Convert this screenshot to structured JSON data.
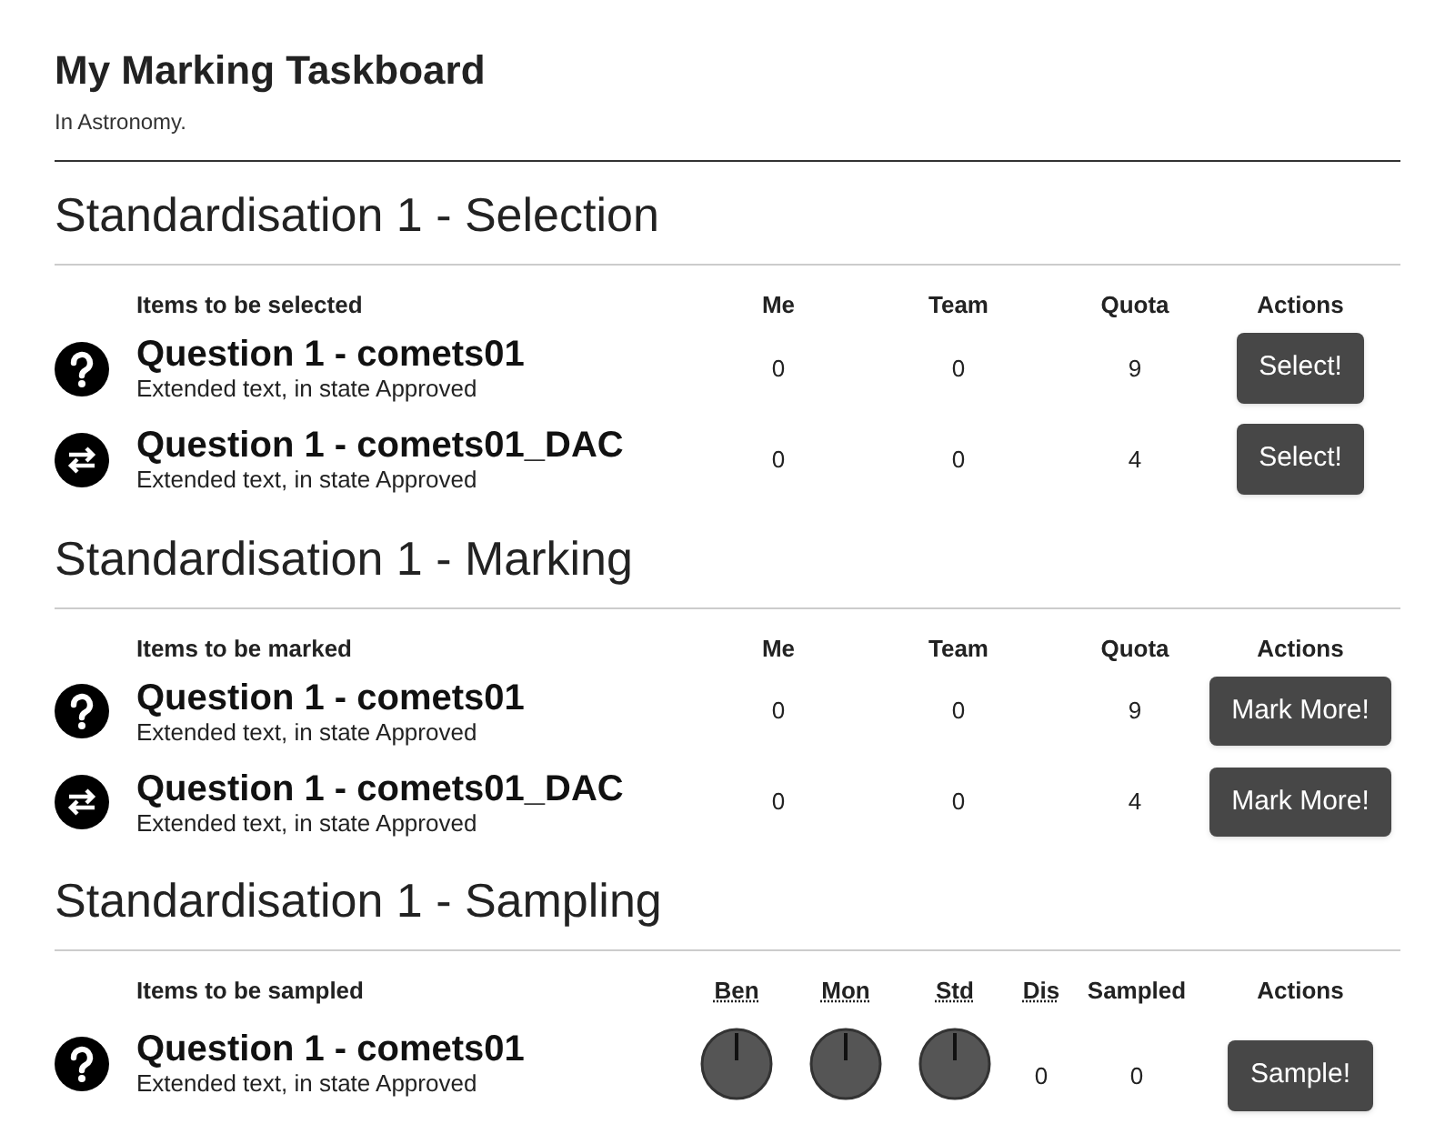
{
  "page": {
    "title": "My Marking Taskboard",
    "subtitle": "In Astronomy."
  },
  "sections": [
    {
      "kind": "standard",
      "heading": "Standardisation 1 - Selection",
      "columns": [
        "Items to be selected",
        "Me",
        "Team",
        "Quota",
        "Actions"
      ],
      "rows": [
        {
          "kind": "question",
          "title": "Question 1 - comets01",
          "description": "Extended text, in state Approved",
          "me": "0",
          "team": "0",
          "quota": "9",
          "action": "Select!"
        },
        {
          "kind": "swap",
          "title": "Question 1 - comets01_DAC",
          "description": "Extended text, in state Approved",
          "me": "0",
          "team": "0",
          "quota": "4",
          "action": "Select!"
        }
      ]
    },
    {
      "kind": "standard",
      "heading": "Standardisation 1 - Marking",
      "columns": [
        "Items to be marked",
        "Me",
        "Team",
        "Quota",
        "Actions"
      ],
      "rows": [
        {
          "kind": "question",
          "title": "Question 1 - comets01",
          "description": "Extended text, in state Approved",
          "me": "0",
          "team": "0",
          "quota": "9",
          "action": "Mark More!"
        },
        {
          "kind": "swap",
          "title": "Question 1 - comets01_DAC",
          "description": "Extended text, in state Approved",
          "me": "0",
          "team": "0",
          "quota": "4",
          "action": "Mark More!"
        }
      ]
    },
    {
      "kind": "sampling",
      "heading": "Standardisation 1 - Sampling",
      "columns": [
        "Items to be sampled",
        "Ben",
        "Mon",
        "Std",
        "Dis",
        "Sampled",
        "Actions"
      ],
      "rows": [
        {
          "kind": "question",
          "title": "Question 1 - comets01",
          "description": "Extended text, in state Approved",
          "dis": "0",
          "sampled": "0",
          "action": "Sample!"
        }
      ]
    }
  ]
}
